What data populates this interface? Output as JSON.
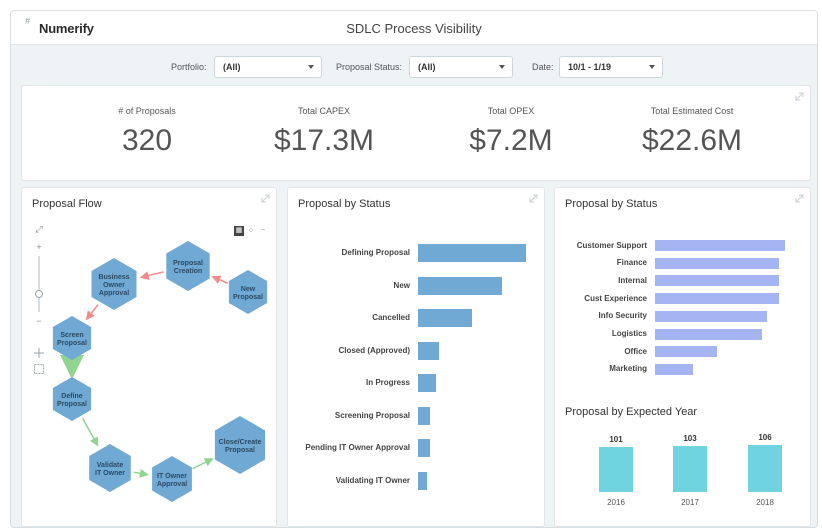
{
  "header": {
    "logo_mark": "#",
    "logo": "Numerify",
    "title": "SDLC Process Visibility"
  },
  "filters": {
    "portfolio": {
      "label": "Portfolio:",
      "value": "(All)"
    },
    "status": {
      "label": "Proposal Status:",
      "value": "(All)"
    },
    "date": {
      "label": "Date:",
      "value": "10/1 - 1/19"
    }
  },
  "kpis": [
    {
      "label": "# of Proposals",
      "value": "320"
    },
    {
      "label": "Total CAPEX",
      "value": "$17.3M"
    },
    {
      "label": "Total OPEX",
      "value": "$7.2M"
    },
    {
      "label": "Total Estimated Cost",
      "value": "$22.6M"
    }
  ],
  "flow": {
    "title": "Proposal Flow",
    "zoom_in": "+",
    "zoom_out": "−",
    "fit": "⤢",
    "nodes": [
      "Proposal Creation",
      "Business Owner Approval",
      "New Proposal",
      "Screen Proposal",
      "Define Proposal",
      "Validate IT Owner",
      "IT Owner Approval",
      "Close/Create Proposal"
    ],
    "colors": {
      "node": "#6fa9d4",
      "arrow_red": "#f28b8b",
      "arrow_green": "#8fd48f"
    }
  },
  "status_chart": {
    "title": "Proposal by Status",
    "chart_data": {
      "type": "bar",
      "orientation": "horizontal",
      "categories": [
        "Defining Proposal",
        "New",
        "Cancelled",
        "Closed (Approved)",
        "In Progress",
        "Screening Proposal",
        "Pending IT Owner Approval",
        "Validating IT Owner"
      ],
      "values": [
        100,
        78,
        50,
        19,
        17,
        11,
        11,
        8
      ]
    }
  },
  "dept_chart": {
    "title": "Proposal by Status",
    "chart_data": {
      "type": "bar",
      "orientation": "horizontal",
      "categories": [
        "Customer Support",
        "Finance",
        "Internal",
        "Cust Experience",
        "Info Security",
        "Logistics",
        "Office",
        "Marketing"
      ],
      "values": [
        100,
        95,
        95,
        95,
        86,
        82,
        48,
        29
      ]
    }
  },
  "year_chart": {
    "title": "Proposal by Expected Year",
    "chart_data": {
      "type": "bar",
      "categories": [
        "2016",
        "2017",
        "2018"
      ],
      "values": [
        101,
        103,
        106
      ],
      "labels": [
        "101",
        "103",
        "106"
      ]
    }
  }
}
